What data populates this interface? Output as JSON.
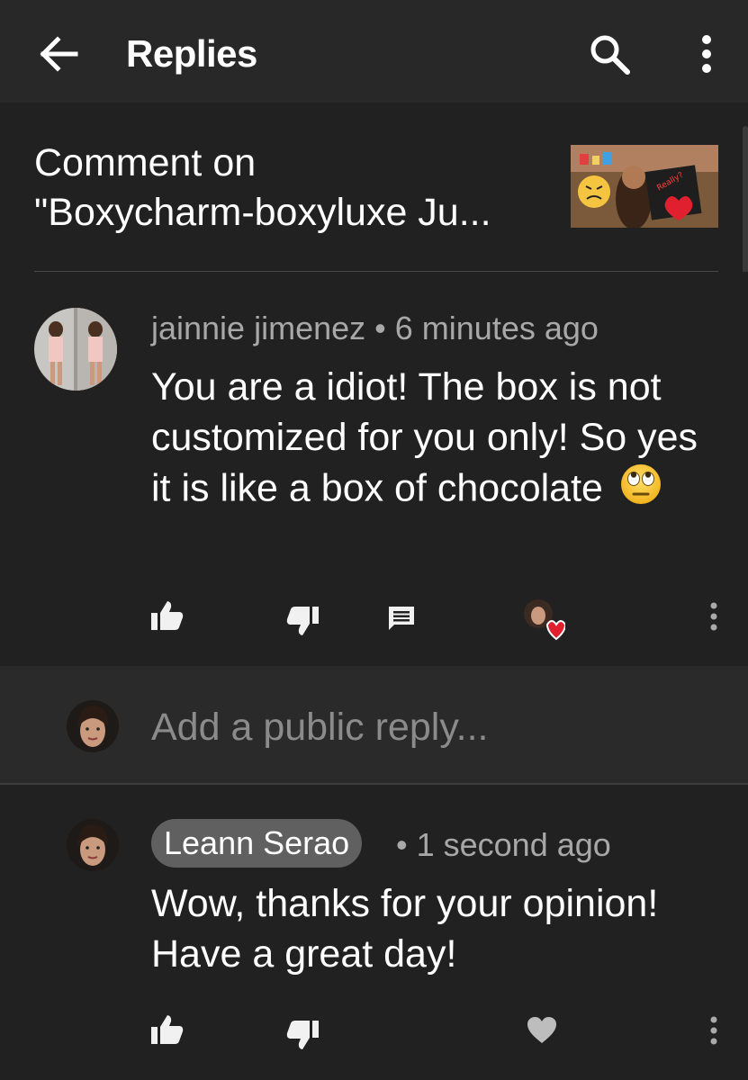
{
  "topbar": {
    "title": "Replies",
    "back_icon": "arrow-left-icon",
    "search_icon": "search-icon",
    "more_icon": "more-vert-icon"
  },
  "video": {
    "title_line1": "Comment on",
    "title_line2": "\"Boxycharm-boxyluxe Ju..."
  },
  "comment": {
    "author": "jainnie jimenez",
    "time": "6 minutes ago",
    "text": "You are a idiot! The box is not customized for you only! So yes it is like a box of chocolate",
    "emoji": "face-with-rolling-eyes"
  },
  "reply_box": {
    "placeholder": "Add a public reply..."
  },
  "reply": {
    "author": "Leann Serao",
    "time": "1 second ago",
    "text": "Wow, thanks for your opinion! Have a great day!"
  },
  "colors": {
    "background": "#212121",
    "topbar": "#282828",
    "reply_box": "#2a2a2a",
    "meta": "#a8a8a8",
    "chip": "#606060",
    "heart": "#e0202e"
  }
}
